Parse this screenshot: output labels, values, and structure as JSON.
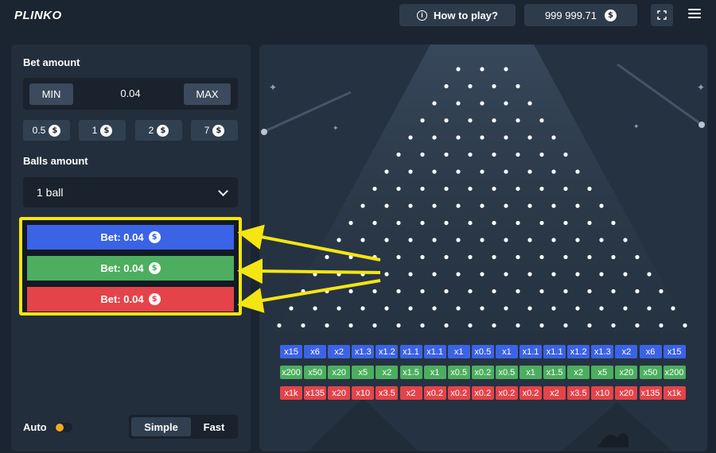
{
  "header": {
    "logo": "PLINKO",
    "how_to_play": "How to play?",
    "balance": "999 999.71",
    "coin_symbol": "$"
  },
  "controls": {
    "bet_amount_label": "Bet amount",
    "min_label": "MIN",
    "max_label": "MAX",
    "bet_value": "0.04",
    "quick_amounts": [
      "0.5",
      "1",
      "2",
      "7"
    ],
    "balls_amount_label": "Balls amount",
    "balls_selected": "1 ball",
    "bet_buttons": [
      {
        "label": "Bet: 0.04",
        "color": "#3b63e6"
      },
      {
        "label": "Bet: 0.04",
        "color": "#4cae5e"
      },
      {
        "label": "Bet: 0.04",
        "color": "#e5434a"
      }
    ],
    "auto_label": "Auto",
    "speed_options": [
      "Simple",
      "Fast"
    ],
    "speed_selected": "Simple"
  },
  "board": {
    "rows": 16,
    "multipliers": {
      "blue": [
        "x15",
        "x6",
        "x2",
        "x1.3",
        "x1.2",
        "x1.1",
        "x1.1",
        "x1",
        "x0.5",
        "x1",
        "x1.1",
        "x1.1",
        "x1.2",
        "x1.3",
        "x2",
        "x6",
        "x15"
      ],
      "green": [
        "x200",
        "x50",
        "x20",
        "x5",
        "x2",
        "x1.5",
        "x1",
        "x0.5",
        "x0.2",
        "x0.5",
        "x1",
        "x1.5",
        "x2",
        "x5",
        "x20",
        "x50",
        "x200"
      ],
      "red": [
        "x1k",
        "x135",
        "x20",
        "x10",
        "x3.5",
        "x2",
        "x0.2",
        "x0.2",
        "x0.2",
        "x0.2",
        "x0.2",
        "x2",
        "x3.5",
        "x10",
        "x20",
        "x135",
        "x1k"
      ]
    },
    "colors": {
      "blue": "#3b63e6",
      "green": "#4cae5e",
      "red": "#e5434a"
    }
  },
  "annotation": {
    "highlight_color": "#f5e512"
  }
}
